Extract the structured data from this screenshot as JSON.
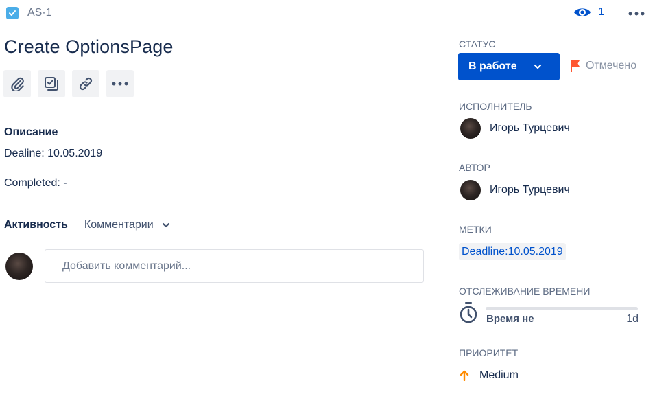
{
  "issue": {
    "key": "AS-1",
    "type_icon": "checkbox-icon",
    "title": "Create OptionsPage"
  },
  "header": {
    "watchers_count": "1",
    "watch_icon": "eye-icon",
    "more_icon": "more-horizontal-icon"
  },
  "toolbar": {
    "buttons": [
      "attachment-icon",
      "subtask-icon",
      "link-icon",
      "more-horizontal-icon"
    ]
  },
  "description": {
    "label": "Описание",
    "lines": [
      "Dealine: 10.05.2019",
      "Completed: -"
    ]
  },
  "activity": {
    "label": "Активность",
    "filter": "Комментарии",
    "comment_placeholder": "Добавить комментарий..."
  },
  "sidebar": {
    "status": {
      "label": "СТАТУС",
      "value": "В работе",
      "done_label": "Отмечено",
      "color": "#0052cc"
    },
    "assignee": {
      "label": "ИСПОЛНИТЕЛЬ",
      "name": "Игорь Турцевич"
    },
    "reporter": {
      "label": "АВТОР",
      "name": "Игорь Турцевич"
    },
    "labels": {
      "label": "МЕТКИ",
      "values": [
        "Deadline:10.05.2019"
      ]
    },
    "time_tracking": {
      "label": "ОТСЛЕЖИВАНИЕ ВРЕМЕНИ",
      "logged": "Время не",
      "remaining": "1d",
      "progress": 0
    },
    "priority": {
      "label": "ПРИОРИТЕТ",
      "value": "Medium",
      "color": "#ff8b00"
    }
  }
}
